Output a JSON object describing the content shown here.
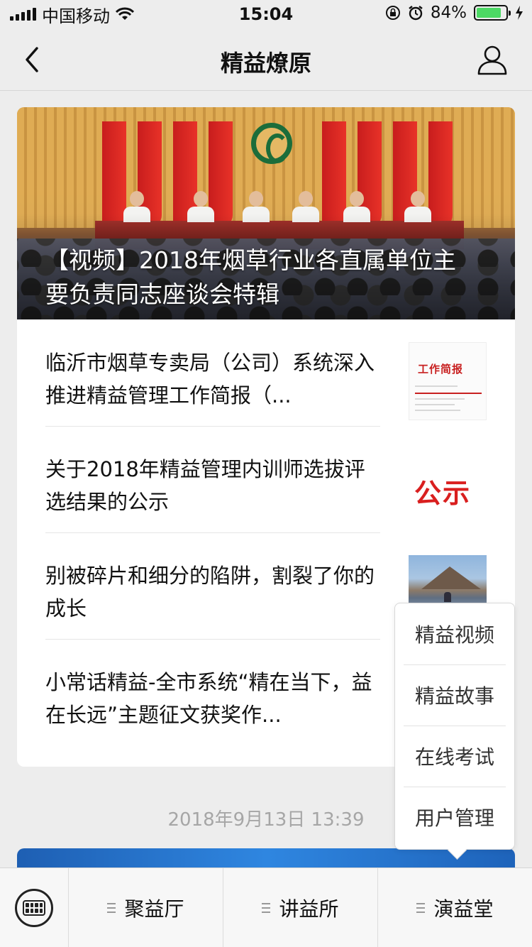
{
  "status_bar": {
    "carrier": "中国移动",
    "time": "15:04",
    "battery_percent": "84%",
    "battery_level": 0.84
  },
  "nav": {
    "title": "精益燎原"
  },
  "featured": {
    "title": "【视频】2018年烟草行业各直属单位主要负责同志座谈会特辑"
  },
  "articles": [
    {
      "title": "临沂市烟草专卖局（公司）系统深入推进精益管理工作简报（...",
      "thumb": "report",
      "thumb_text": "工作简报"
    },
    {
      "title": "关于2018年精益管理内训师选拔评选结果的公示",
      "thumb": "notice",
      "thumb_text": "公示"
    },
    {
      "title": "别被碎片和细分的陷阱，割裂了你的成长",
      "thumb": "lake",
      "thumb_text": ""
    },
    {
      "title": "小常话精益-全市系统“精在当下，益在长远”主题征文获奖作...",
      "thumb": "none",
      "thumb_text": ""
    }
  ],
  "timestamp": "2018年9月13日 13:39",
  "popup_menu": {
    "items": [
      "精益视频",
      "精益故事",
      "在线考试",
      "用户管理"
    ]
  },
  "bottom_menu": {
    "tabs": [
      "聚益厅",
      "讲益所",
      "演益堂"
    ]
  },
  "colors": {
    "battery_green": "#4cd964",
    "notice_red": "#d91f1f"
  }
}
